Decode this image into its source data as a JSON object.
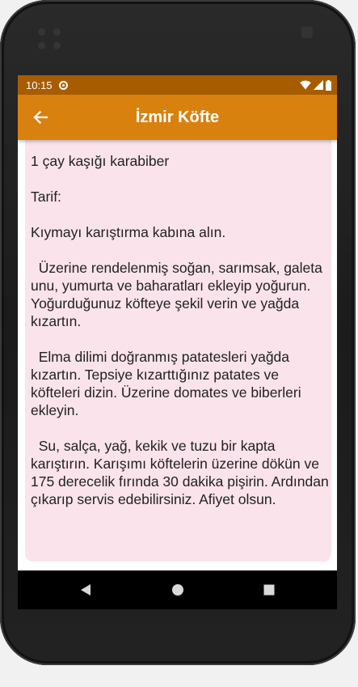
{
  "status_bar": {
    "time": "10:15",
    "icons": [
      "app-notification-icon",
      "wifi-icon",
      "signal-icon",
      "battery-icon"
    ]
  },
  "app_bar": {
    "back_icon": "arrow-left-icon",
    "title": "İzmir Köfte"
  },
  "recipe": {
    "text": "1 çay kaşığı karabiber\n\nTarif:\n\nKıymayı karıştırma kabına alın.\n\n  Üzerine rendelenmiş soğan, sarımsak, galeta unu, yumurta ve baharatları ekleyip yoğurun. Yoğurduğunuz köfteye şekil verin ve yağda kızartın.\n\n  Elma dilimi doğranmış patatesleri yağda kızartın. Tepsiye kızarttığınız patates ve köfteleri dizin. Üzerine domates ve biberleri ekleyin.\n\n  Su, salça, yağ, kekik ve tuzu bir kapta karıştırın. Karışımı köftelerin üzerine dökün ve 175 derecelik fırında 30 dakika pişirin. Ardından çıkarıp servis edebilirsiniz. Afiyet olsun."
  },
  "nav_bar": {
    "icons": [
      "nav-back-icon",
      "nav-home-icon",
      "nav-recents-icon"
    ]
  },
  "colors": {
    "app_bar": "#d8810f",
    "status_bar": "#a85c00",
    "card_background": "#fae3eb"
  }
}
